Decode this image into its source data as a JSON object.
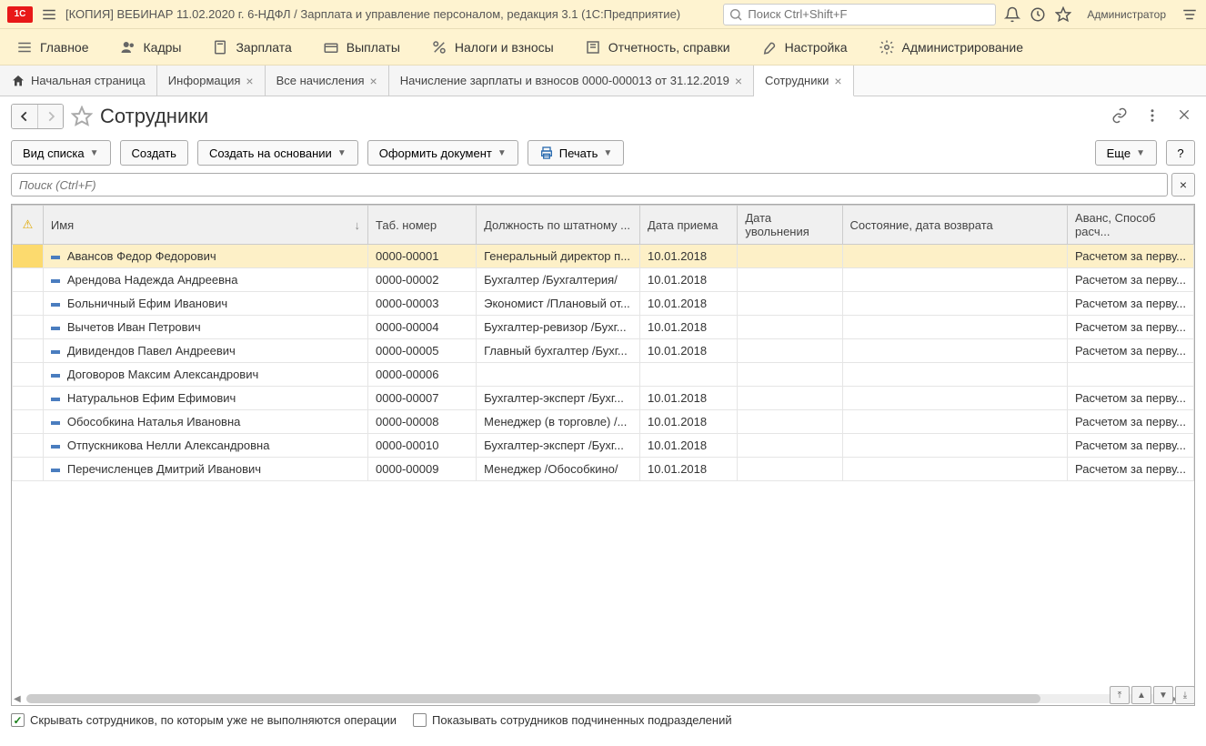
{
  "topbar": {
    "title": "[КОПИЯ] ВЕБИНАР 11.02.2020 г. 6-НДФЛ / Зарплата и управление персоналом, редакция 3.1  (1С:Предприятие)",
    "search_placeholder": "Поиск Ctrl+Shift+F",
    "user": "Администратор"
  },
  "nav": {
    "items": [
      {
        "label": "Главное"
      },
      {
        "label": "Кадры"
      },
      {
        "label": "Зарплата"
      },
      {
        "label": "Выплаты"
      },
      {
        "label": "Налоги и взносы"
      },
      {
        "label": "Отчетность, справки"
      },
      {
        "label": "Настройка"
      },
      {
        "label": "Администрирование"
      }
    ]
  },
  "tabs": {
    "items": [
      {
        "label": "Начальная страница",
        "closeable": false,
        "home": true
      },
      {
        "label": "Информация",
        "closeable": true
      },
      {
        "label": "Все начисления",
        "closeable": true
      },
      {
        "label": "Начисление зарплаты и взносов 0000-000013 от 31.12.2019",
        "closeable": true
      },
      {
        "label": "Сотрудники",
        "closeable": true,
        "active": true
      }
    ]
  },
  "page": {
    "title": "Сотрудники"
  },
  "toolbar": {
    "view_list": "Вид списка",
    "create": "Создать",
    "create_based": "Создать на основании",
    "make_doc": "Оформить документ",
    "print": "Печать",
    "more": "Еще",
    "help": "?"
  },
  "filter": {
    "placeholder": "Поиск (Ctrl+F)"
  },
  "table": {
    "headers": {
      "name": "Имя",
      "num": "Таб. номер",
      "pos": "Должность по штатному ...",
      "hire": "Дата приема",
      "fire": "Дата увольнения",
      "state": "Состояние, дата возврата",
      "adv": "Аванс, Способ расч..."
    },
    "rows": [
      {
        "name": "Авансов Федор Федорович",
        "num": "0000-00001",
        "pos": "Генеральный директор п...",
        "hire": "10.01.2018",
        "fire": "",
        "state": "",
        "adv": "Расчетом за перву...",
        "selected": true
      },
      {
        "name": "Арендова Надежда Андреевна",
        "num": "0000-00002",
        "pos": "Бухгалтер /Бухгалтерия/",
        "hire": "10.01.2018",
        "fire": "",
        "state": "",
        "adv": "Расчетом за перву..."
      },
      {
        "name": "Больничный Ефим Иванович",
        "num": "0000-00003",
        "pos": "Экономист /Плановый от...",
        "hire": "10.01.2018",
        "fire": "",
        "state": "",
        "adv": "Расчетом за перву..."
      },
      {
        "name": "Вычетов Иван Петрович",
        "num": "0000-00004",
        "pos": "Бухгалтер-ревизор /Бухг...",
        "hire": "10.01.2018",
        "fire": "",
        "state": "",
        "adv": "Расчетом за перву..."
      },
      {
        "name": "Дивидендов Павел Андреевич",
        "num": "0000-00005",
        "pos": "Главный бухгалтер /Бухг...",
        "hire": "10.01.2018",
        "fire": "",
        "state": "",
        "adv": "Расчетом за перву..."
      },
      {
        "name": "Договоров Максим Александрович",
        "num": "0000-00006",
        "pos": "",
        "hire": "",
        "fire": "",
        "state": "",
        "adv": ""
      },
      {
        "name": "Натуральнов Ефим Ефимович",
        "num": "0000-00007",
        "pos": "Бухгалтер-эксперт /Бухг...",
        "hire": "10.01.2018",
        "fire": "",
        "state": "",
        "adv": "Расчетом за перву..."
      },
      {
        "name": "Обособкина Наталья Ивановна",
        "num": "0000-00008",
        "pos": "Менеджер (в торговле) /...",
        "hire": "10.01.2018",
        "fire": "",
        "state": "",
        "adv": "Расчетом за перву..."
      },
      {
        "name": "Отпускникова Нелли Александровна",
        "num": "0000-00010",
        "pos": "Бухгалтер-эксперт /Бухг...",
        "hire": "10.01.2018",
        "fire": "",
        "state": "",
        "adv": "Расчетом за перву..."
      },
      {
        "name": "Перечисленцев Дмитрий Иванович",
        "num": "0000-00009",
        "pos": "Менеджер /Обособкино/",
        "hire": "10.01.2018",
        "fire": "",
        "state": "",
        "adv": "Расчетом за перву..."
      }
    ]
  },
  "footer": {
    "hide_inactive": "Скрывать сотрудников, по которым уже не выполняются операции",
    "show_sub": "Показывать сотрудников подчиненных подразделений"
  }
}
